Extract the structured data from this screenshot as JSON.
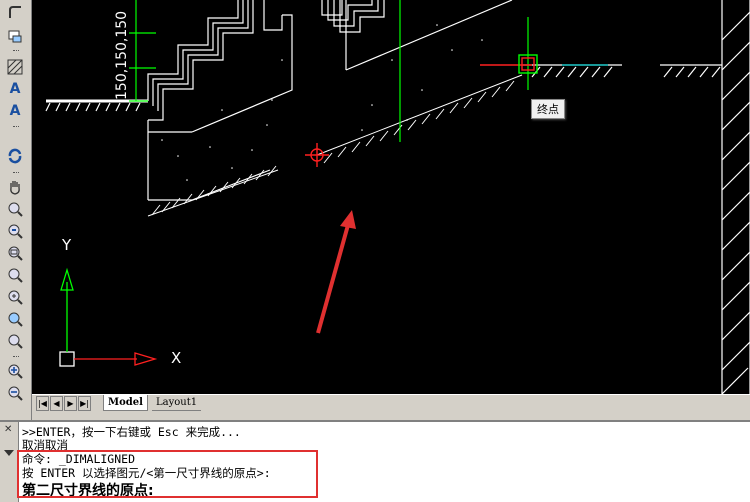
{
  "toolbar": {
    "icons": [
      "fillet-icon",
      "edit-icon",
      "hatch-icon",
      "text-A-icon",
      "mtext-A-icon",
      "regen-icon",
      "pan-hand-icon",
      "zoom-realtime-icon",
      "zoom-previous-icon",
      "zoom-window-icon",
      "zoom-dynamic-icon",
      "zoom-scale-icon",
      "zoom-center-icon",
      "zoom-object-icon",
      "zoom-in-icon",
      "zoom-out-icon"
    ]
  },
  "drawing": {
    "dimension_text": "150,150,150",
    "axis_x_label": "X",
    "axis_y_label": "Y",
    "snap_tooltip": "终点",
    "colors": {
      "background": "#000000",
      "lines": "#ffffff",
      "dimension": "#00ff00",
      "snap": "#ff2020",
      "annotation_arrow": "#e03030"
    }
  },
  "layout_tabs": {
    "model": "Model",
    "layout1": "Layout1",
    "nav": [
      "|◀",
      "◀",
      "▶",
      "▶|"
    ]
  },
  "command_line": {
    "lines": [
      ">>ENTER，按一下右键或 Esc 来完成...",
      "取消取消",
      "命令: _DIMALIGNED",
      "按 ENTER 以选择图元/<第一尺寸界线的原点>:",
      "第二尺寸界线的原点:"
    ]
  }
}
